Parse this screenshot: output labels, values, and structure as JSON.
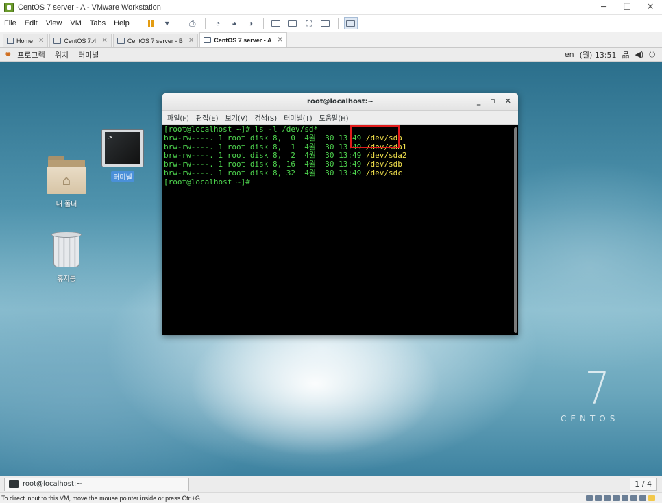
{
  "vmware": {
    "window_title": "CentOS 7 server - A - VMware Workstation",
    "window_controls": {
      "minimize": "─",
      "maximize": "☐",
      "close": "✕"
    },
    "menu": [
      "File",
      "Edit",
      "View",
      "VM",
      "Tabs",
      "Help"
    ],
    "tabs": [
      {
        "label": "Home",
        "close": "✕"
      },
      {
        "label": "CentOS 7.4",
        "close": "✕"
      },
      {
        "label": "CentOS 7 server - B",
        "close": "✕"
      },
      {
        "label": "CentOS 7 server - A",
        "close": "✕"
      }
    ],
    "status_message": "To direct input to this VM, move the mouse pointer inside or press Ctrl+G."
  },
  "gnome": {
    "top_menu": [
      "프로그램",
      "위치",
      "터미널"
    ],
    "input_lang": "en",
    "clock": "(월) 13:51",
    "taskbar_item": "root@localhost:~",
    "workspace": "1 / 4"
  },
  "desktop": {
    "icons": [
      "터미널",
      "내 폴더",
      "휴지통"
    ],
    "folder_glyph": "⌂",
    "terminal_prompt_glyph": ">_",
    "logo_number": "7",
    "logo_word": "CENTOS"
  },
  "terminal": {
    "title": "root@localhost:~",
    "controls": {
      "minimize": "_",
      "maximize": "▫",
      "close": "✕"
    },
    "menu": [
      "파일(F)",
      "편집(E)",
      "보기(V)",
      "검색(S)",
      "터미널(T)",
      "도움말(H)"
    ],
    "lines": [
      {
        "text": "[root@localhost ~]# ls -l /dev/sd*",
        "dev": ""
      },
      {
        "text": "brw-rw----. 1 root disk 8,  0  4월  30 13:49 ",
        "dev": "/dev/sda"
      },
      {
        "text": "brw-rw----. 1 root disk 8,  1  4월  30 13:49 ",
        "dev": "/dev/sda1"
      },
      {
        "text": "brw-rw----. 1 root disk 8,  2  4월  30 13:49 ",
        "dev": "/dev/sda2"
      },
      {
        "text": "brw-rw----. 1 root disk 8, 16  4월  30 13:49 ",
        "dev": "/dev/sdb"
      },
      {
        "text": "brw-rw----. 1 root disk 8, 32  4월  30 13:49 ",
        "dev": "/dev/sdc"
      },
      {
        "text": "[root@localhost ~]# ",
        "dev": ""
      }
    ]
  },
  "colors": {
    "terminal_text": "#4fd64f",
    "terminal_device": "#f1e04c",
    "highlight_box": "#e01c1c",
    "selected_label": "#4a90d9"
  }
}
